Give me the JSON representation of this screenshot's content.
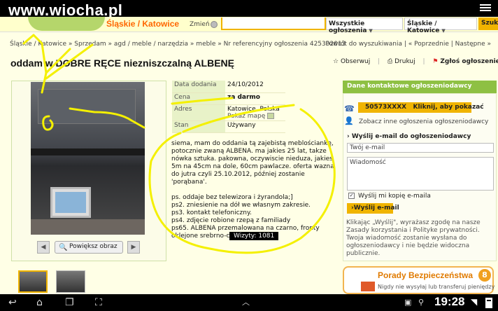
{
  "status_bar": {
    "watermark": "www.wiocha.pl",
    "time": "19:28"
  },
  "header": {
    "region": "Śląskie / Katowice",
    "change_label": "Zmień",
    "category_select": "Wszystkie ogłoszenia",
    "region_select": "Śląskie / Katowice",
    "search_button": "Szukaj"
  },
  "breadcrumb": {
    "items": [
      "Śląskie / Katowice",
      "Sprzedam",
      "agd / meble / narzędzia",
      "meble"
    ],
    "ref": "Nr referencyjny ogłoszenia 425302013"
  },
  "nav": {
    "back": "Powrót do wyszukiwania",
    "prev": "Poprzednie",
    "next": "Następne"
  },
  "listing": {
    "title": "oddam w DOBRE RĘCE niezniszczalną ALBENĘ",
    "actions": {
      "watch": "Obserwuj",
      "print": "Drukuj",
      "report": "Zgłoś ogłoszenie"
    },
    "enlarge": "Powiększ obraz",
    "details": [
      {
        "label": "Data dodania",
        "value": "24/10/2012"
      },
      {
        "label": "Cena",
        "value": "za darmo"
      },
      {
        "label": "Adres",
        "value": "Katowice, Polska",
        "extra": "Pokaż mapę"
      },
      {
        "label": "Stan",
        "value": "Używany"
      }
    ],
    "description": "siema, mam do oddania tą zajebistą meblościankę, potocznie zwaną ALBENA. ma jakies 25 lat, takze nówka sztuka. pakowna, oczywiscie nieduza, jakies 5m na 45cm na dole, 60cm pawlacze. oferta wazna do jutra czyli 25.10.2012, później zostanie 'porąbana'.\n\nps. oddaje bez telewizora i żyrandola;]\nps2. zniesienie na dół we własnym zakresie.\nps3. kontakt telefoniczny.\nps4. zdjęcie robione rzepą z familiady\nps65. ALBENA przemalowana na czarno, fronty oklejone srebrno-czarną okleiną.",
    "visits": "Wizyty: 1081"
  },
  "contact": {
    "header": "Dane kontaktowe ogłoszeniodawcy",
    "phone_number": "50573XXXX",
    "phone_cta": "Kliknij, aby pokazać",
    "other_ads": "Zobacz inne ogłoszenia ogłoszeniodawcy",
    "email_title": "Wyślij e-mail do ogłoszeniodawcy",
    "email_placeholder": "Twój e-mail",
    "message_placeholder": "Wiadomość",
    "copy_label": "Wyślij mi kopię e-maila",
    "send_button": "Wyślij e-mail",
    "legal": "Klikając „Wyślij\", wyrażasz zgodę na nasze Zasady korzystania i Polityke prywatności. Twoja wiadomość zostanie wysłana do ogłoszeniodawcy i nie będzie widoczna publicznie."
  },
  "safety": {
    "title": "Porady Bezpieczeństwa",
    "badge": "8",
    "line": "Nigdy nie wysyłaj lub transferuj pieniędzy"
  },
  "colors": {
    "accent": "#f0b400",
    "green": "#8ec043",
    "orange": "#ff6600",
    "scribble": "#f4f000"
  }
}
